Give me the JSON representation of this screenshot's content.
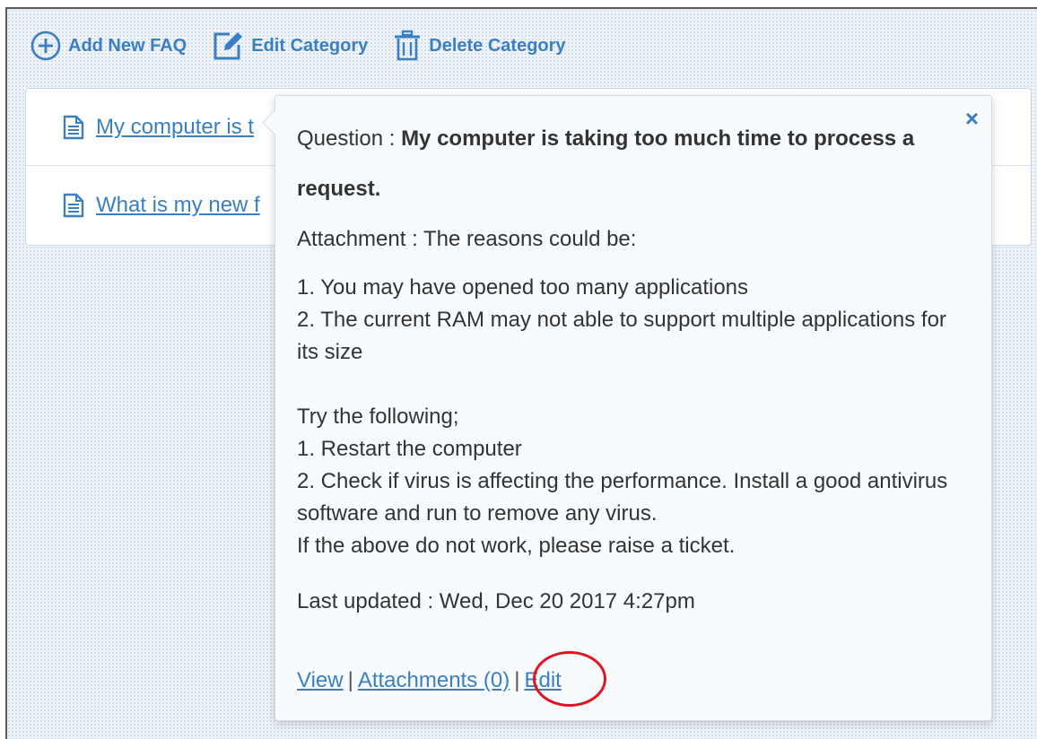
{
  "toolbar": {
    "add_new_faq": "Add New FAQ",
    "edit_category": "Edit Category",
    "delete_category": "Delete Category"
  },
  "faq_list": [
    {
      "title": "My computer is t"
    },
    {
      "title": "What is my new f"
    }
  ],
  "popover": {
    "close_label": "×",
    "question_label": "Question : ",
    "question_text": "My computer is taking too much time to process a request.",
    "attachment_line": "Attachment : The reasons could be:",
    "body": "1. You may have opened too many applications\n2. The current RAM may not able to support multiple applications for its size\n\nTry the following;\n1. Restart the computer\n2. Check if virus is affecting the performance. Install a good antivirus software and run to remove any virus.\nIf the above do not work, please raise a ticket.",
    "last_updated": "Last updated : Wed, Dec 20 2017 4:27pm",
    "links": {
      "view": "View",
      "attachments": "Attachments (0)",
      "edit": "Edit",
      "separator": "|"
    }
  },
  "colors": {
    "link": "#3a7fc1",
    "highlight": "#e0141e"
  },
  "icons": [
    "plus-circle-icon",
    "edit-icon",
    "trash-icon",
    "document-icon",
    "close-icon"
  ]
}
